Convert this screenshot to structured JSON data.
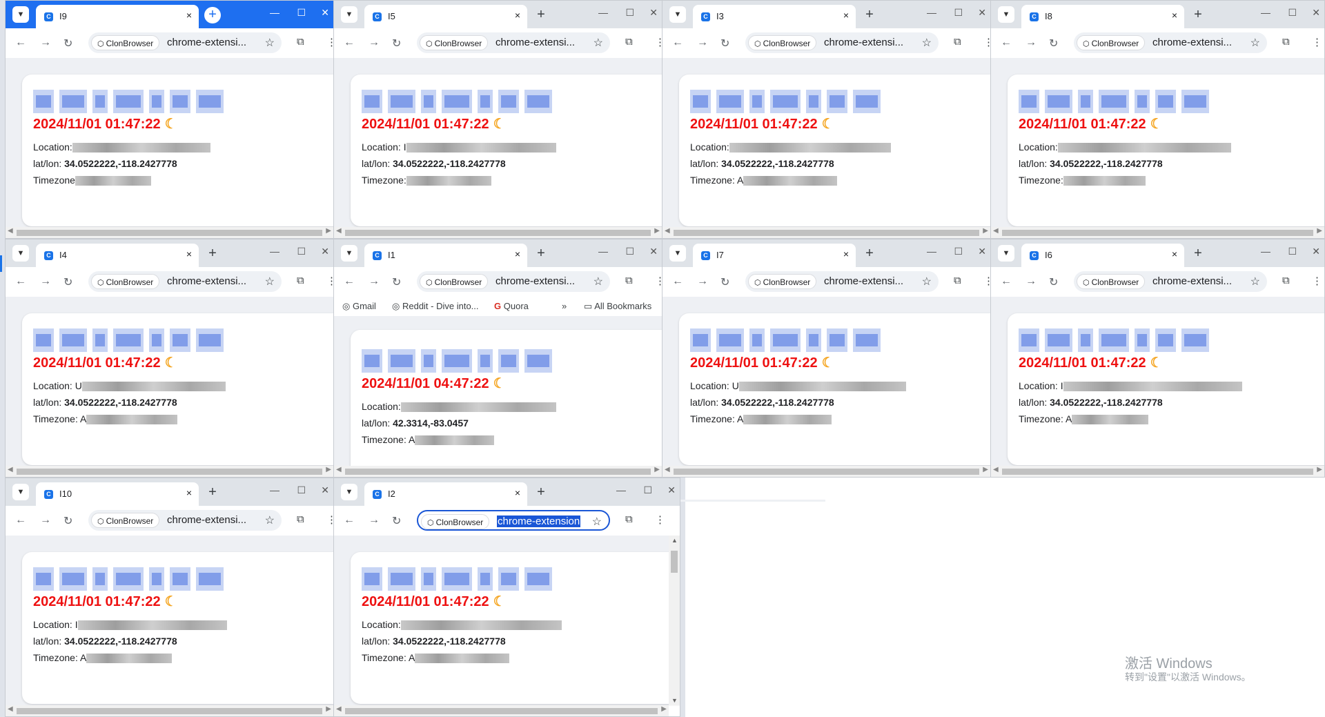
{
  "windows": [
    {
      "tab": "I9",
      "url": "chrome-extensi...",
      "datetime": "2024/11/01 01:47:22",
      "location_label": "Location:",
      "latlon_label": "lat/lon:",
      "latlon": "34.0522222,-118.2427778",
      "timezone_label": "Timezone"
    },
    {
      "tab": "I5",
      "url": "chrome-extensi...",
      "datetime": "2024/11/01 01:47:22",
      "location_label": "Location: I",
      "latlon_label": "lat/lon:",
      "latlon": "34.0522222,-118.2427778",
      "timezone_label": "Timezone:"
    },
    {
      "tab": "I3",
      "url": "chrome-extensi...",
      "datetime": "2024/11/01 01:47:22",
      "location_label": "Location:",
      "latlon_label": "lat/lon:",
      "latlon": "34.0522222,-118.2427778",
      "timezone_label": "Timezone: A"
    },
    {
      "tab": "I8",
      "url": "chrome-extensi...",
      "datetime": "2024/11/01 01:47:22",
      "location_label": "Location:",
      "latlon_label": "lat/lon:",
      "latlon": "34.0522222,-118.2427778",
      "timezone_label": "Timezone:"
    },
    {
      "tab": "I4",
      "url": "chrome-extensi...",
      "datetime": "2024/11/01 01:47:22",
      "location_label": "Location: U",
      "latlon_label": "lat/lon:",
      "latlon": "34.0522222,-118.2427778",
      "timezone_label": "Timezone: A"
    },
    {
      "tab": "I1",
      "url": "chrome-extensi...",
      "datetime": "2024/11/01 04:47:22",
      "location_label": "Location:",
      "latlon_label": "lat/lon:",
      "latlon": "42.3314,-83.0457",
      "timezone_label": "Timezone: A"
    },
    {
      "tab": "I7",
      "url": "chrome-extensi...",
      "datetime": "2024/11/01 01:47:22",
      "location_label": "Location: U",
      "latlon_label": "lat/lon:",
      "latlon": "34.0522222,-118.2427778",
      "timezone_label": "Timezone: A"
    },
    {
      "tab": "I6",
      "url": "chrome-extensi...",
      "datetime": "2024/11/01 01:47:22",
      "location_label": "Location: I",
      "latlon_label": "lat/lon:",
      "latlon": "34.0522222,-118.2427778",
      "timezone_label": "Timezone: A"
    },
    {
      "tab": "I10",
      "url": "chrome-extensi...",
      "datetime": "2024/11/01 01:47:22",
      "location_label": "Location: I",
      "latlon_label": "lat/lon:",
      "latlon": "34.0522222,-118.2427778",
      "timezone_label": "Timezone: A"
    },
    {
      "tab": "I2",
      "url": "chrome-extension",
      "datetime": "2024/11/01 01:47:22",
      "location_label": "Location:",
      "latlon_label": "lat/lon:",
      "latlon": "34.0522222,-118.2427778",
      "timezone_label": "Timezone: A"
    }
  ],
  "browser": {
    "chip": "ClonBrowser",
    "tabsearch_icon": "chevron-down-icon",
    "newtab": "+",
    "close": "×"
  },
  "bookmarks": [
    "Gmail",
    "Reddit - Dive into...",
    "Quora",
    "»",
    "All Bookmarks"
  ],
  "activation": {
    "line1": "激活 Windows",
    "line2": "转到\"设置\"以激活 Windows。"
  },
  "colors": {
    "accent_blue": "#1e6ff0",
    "datetime_red": "#ee1111",
    "moon": "#f5a623",
    "selection": "#1a56d6"
  }
}
